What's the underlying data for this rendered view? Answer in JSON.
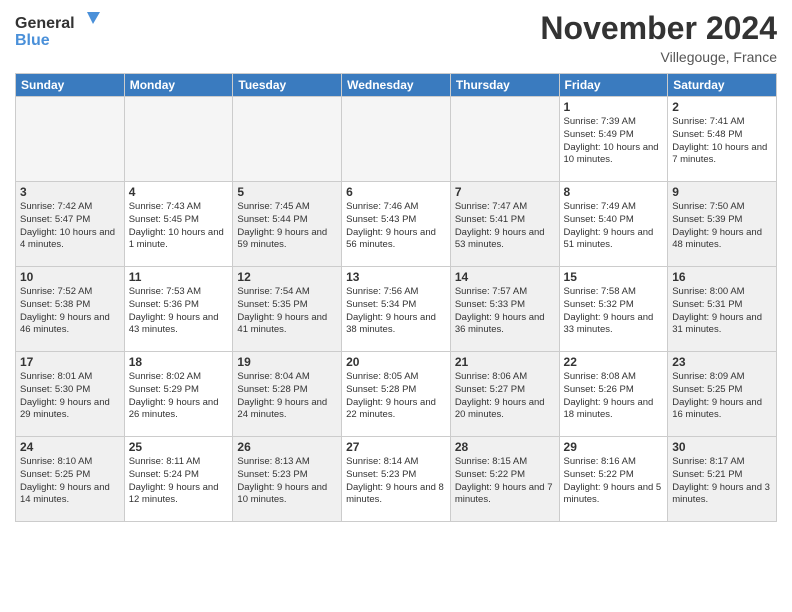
{
  "header": {
    "logo_general": "General",
    "logo_blue": "Blue",
    "title": "November 2024",
    "location": "Villegouge, France"
  },
  "weekdays": [
    "Sunday",
    "Monday",
    "Tuesday",
    "Wednesday",
    "Thursday",
    "Friday",
    "Saturday"
  ],
  "weeks": [
    [
      {
        "day": "",
        "info": "",
        "empty": true
      },
      {
        "day": "",
        "info": "",
        "empty": true
      },
      {
        "day": "",
        "info": "",
        "empty": true
      },
      {
        "day": "",
        "info": "",
        "empty": true
      },
      {
        "day": "",
        "info": "",
        "empty": true
      },
      {
        "day": "1",
        "info": "Sunrise: 7:39 AM\nSunset: 5:49 PM\nDaylight: 10 hours and 10 minutes.",
        "empty": false
      },
      {
        "day": "2",
        "info": "Sunrise: 7:41 AM\nSunset: 5:48 PM\nDaylight: 10 hours and 7 minutes.",
        "empty": false
      }
    ],
    [
      {
        "day": "3",
        "info": "Sunrise: 7:42 AM\nSunset: 5:47 PM\nDaylight: 10 hours and 4 minutes.",
        "shaded": true
      },
      {
        "day": "4",
        "info": "Sunrise: 7:43 AM\nSunset: 5:45 PM\nDaylight: 10 hours and 1 minute.",
        "shaded": false
      },
      {
        "day": "5",
        "info": "Sunrise: 7:45 AM\nSunset: 5:44 PM\nDaylight: 9 hours and 59 minutes.",
        "shaded": true
      },
      {
        "day": "6",
        "info": "Sunrise: 7:46 AM\nSunset: 5:43 PM\nDaylight: 9 hours and 56 minutes.",
        "shaded": false
      },
      {
        "day": "7",
        "info": "Sunrise: 7:47 AM\nSunset: 5:41 PM\nDaylight: 9 hours and 53 minutes.",
        "shaded": true
      },
      {
        "day": "8",
        "info": "Sunrise: 7:49 AM\nSunset: 5:40 PM\nDaylight: 9 hours and 51 minutes.",
        "shaded": false
      },
      {
        "day": "9",
        "info": "Sunrise: 7:50 AM\nSunset: 5:39 PM\nDaylight: 9 hours and 48 minutes.",
        "shaded": true
      }
    ],
    [
      {
        "day": "10",
        "info": "Sunrise: 7:52 AM\nSunset: 5:38 PM\nDaylight: 9 hours and 46 minutes.",
        "shaded": true
      },
      {
        "day": "11",
        "info": "Sunrise: 7:53 AM\nSunset: 5:36 PM\nDaylight: 9 hours and 43 minutes.",
        "shaded": false
      },
      {
        "day": "12",
        "info": "Sunrise: 7:54 AM\nSunset: 5:35 PM\nDaylight: 9 hours and 41 minutes.",
        "shaded": true
      },
      {
        "day": "13",
        "info": "Sunrise: 7:56 AM\nSunset: 5:34 PM\nDaylight: 9 hours and 38 minutes.",
        "shaded": false
      },
      {
        "day": "14",
        "info": "Sunrise: 7:57 AM\nSunset: 5:33 PM\nDaylight: 9 hours and 36 minutes.",
        "shaded": true
      },
      {
        "day": "15",
        "info": "Sunrise: 7:58 AM\nSunset: 5:32 PM\nDaylight: 9 hours and 33 minutes.",
        "shaded": false
      },
      {
        "day": "16",
        "info": "Sunrise: 8:00 AM\nSunset: 5:31 PM\nDaylight: 9 hours and 31 minutes.",
        "shaded": true
      }
    ],
    [
      {
        "day": "17",
        "info": "Sunrise: 8:01 AM\nSunset: 5:30 PM\nDaylight: 9 hours and 29 minutes.",
        "shaded": true
      },
      {
        "day": "18",
        "info": "Sunrise: 8:02 AM\nSunset: 5:29 PM\nDaylight: 9 hours and 26 minutes.",
        "shaded": false
      },
      {
        "day": "19",
        "info": "Sunrise: 8:04 AM\nSunset: 5:28 PM\nDaylight: 9 hours and 24 minutes.",
        "shaded": true
      },
      {
        "day": "20",
        "info": "Sunrise: 8:05 AM\nSunset: 5:28 PM\nDaylight: 9 hours and 22 minutes.",
        "shaded": false
      },
      {
        "day": "21",
        "info": "Sunrise: 8:06 AM\nSunset: 5:27 PM\nDaylight: 9 hours and 20 minutes.",
        "shaded": true
      },
      {
        "day": "22",
        "info": "Sunrise: 8:08 AM\nSunset: 5:26 PM\nDaylight: 9 hours and 18 minutes.",
        "shaded": false
      },
      {
        "day": "23",
        "info": "Sunrise: 8:09 AM\nSunset: 5:25 PM\nDaylight: 9 hours and 16 minutes.",
        "shaded": true
      }
    ],
    [
      {
        "day": "24",
        "info": "Sunrise: 8:10 AM\nSunset: 5:25 PM\nDaylight: 9 hours and 14 minutes.",
        "shaded": true
      },
      {
        "day": "25",
        "info": "Sunrise: 8:11 AM\nSunset: 5:24 PM\nDaylight: 9 hours and 12 minutes.",
        "shaded": false
      },
      {
        "day": "26",
        "info": "Sunrise: 8:13 AM\nSunset: 5:23 PM\nDaylight: 9 hours and 10 minutes.",
        "shaded": true
      },
      {
        "day": "27",
        "info": "Sunrise: 8:14 AM\nSunset: 5:23 PM\nDaylight: 9 hours and 8 minutes.",
        "shaded": false
      },
      {
        "day": "28",
        "info": "Sunrise: 8:15 AM\nSunset: 5:22 PM\nDaylight: 9 hours and 7 minutes.",
        "shaded": true
      },
      {
        "day": "29",
        "info": "Sunrise: 8:16 AM\nSunset: 5:22 PM\nDaylight: 9 hours and 5 minutes.",
        "shaded": false
      },
      {
        "day": "30",
        "info": "Sunrise: 8:17 AM\nSunset: 5:21 PM\nDaylight: 9 hours and 3 minutes.",
        "shaded": true
      }
    ]
  ]
}
